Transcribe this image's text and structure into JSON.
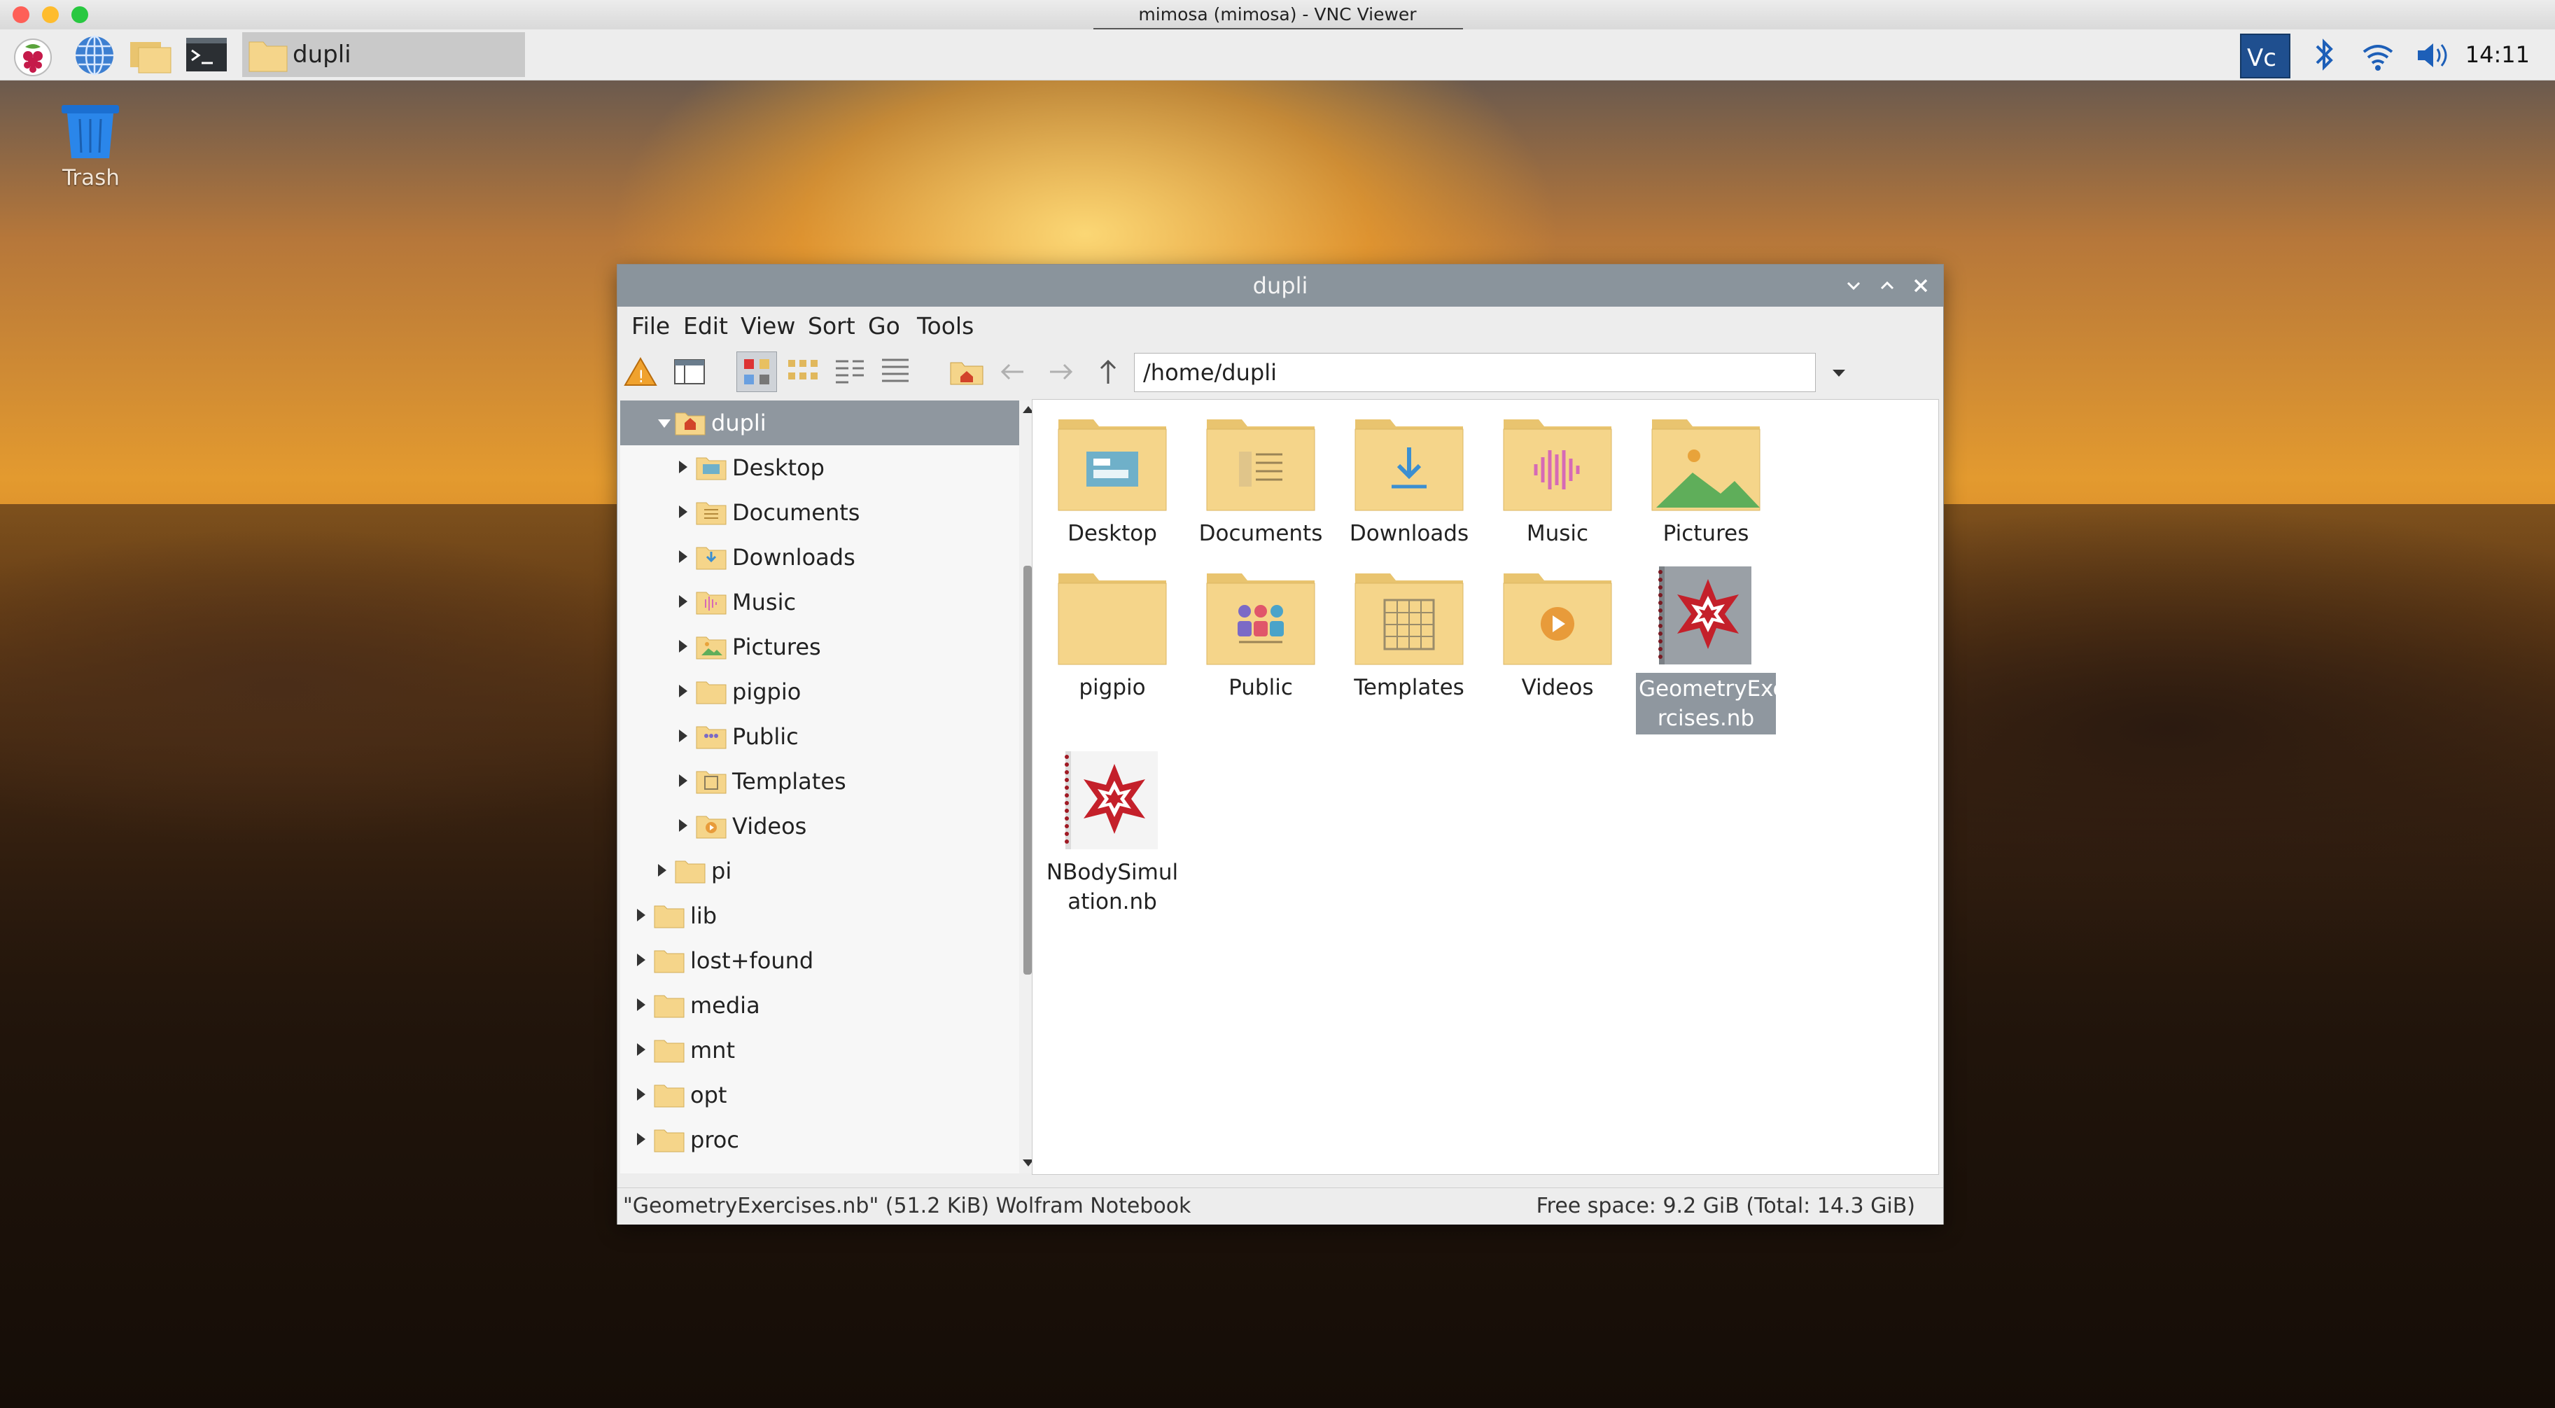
{
  "mac_window": {
    "title": "mimosa (mimosa) - VNC Viewer"
  },
  "taskbar": {
    "window_button_label": "dupli",
    "clock": "14:11",
    "icons": [
      "raspberry-menu-icon",
      "web-browser-icon",
      "file-manager-icon",
      "terminal-icon",
      "vnc-icon",
      "bluetooth-icon",
      "wifi-icon",
      "volume-icon"
    ]
  },
  "desktop": {
    "trash_label": "Trash"
  },
  "file_manager": {
    "title": "dupli",
    "menu": [
      "File",
      "Edit",
      "View",
      "Sort",
      "Go",
      "Tools"
    ],
    "path": "/home/dupli",
    "tree": [
      {
        "label": "dupli",
        "level": 1,
        "expanded": true,
        "selected": true,
        "icon": "home"
      },
      {
        "label": "Desktop",
        "level": 2,
        "icon": "desktop"
      },
      {
        "label": "Documents",
        "level": 2,
        "icon": "documents"
      },
      {
        "label": "Downloads",
        "level": 2,
        "icon": "downloads"
      },
      {
        "label": "Music",
        "level": 2,
        "icon": "music"
      },
      {
        "label": "Pictures",
        "level": 2,
        "icon": "pictures"
      },
      {
        "label": "pigpio",
        "level": 2,
        "icon": "folder"
      },
      {
        "label": "Public",
        "level": 2,
        "icon": "public"
      },
      {
        "label": "Templates",
        "level": 2,
        "icon": "templates"
      },
      {
        "label": "Videos",
        "level": 2,
        "icon": "videos"
      },
      {
        "label": "pi",
        "level": 1,
        "icon": "folder"
      },
      {
        "label": "lib",
        "level": 0,
        "icon": "folder"
      },
      {
        "label": "lost+found",
        "level": 0,
        "icon": "folder"
      },
      {
        "label": "media",
        "level": 0,
        "icon": "folder"
      },
      {
        "label": "mnt",
        "level": 0,
        "icon": "folder"
      },
      {
        "label": "opt",
        "level": 0,
        "icon": "folder"
      },
      {
        "label": "proc",
        "level": 0,
        "icon": "folder"
      }
    ],
    "items": [
      {
        "name": "Desktop",
        "type": "desktop-folder"
      },
      {
        "name": "Documents",
        "type": "documents-folder"
      },
      {
        "name": "Downloads",
        "type": "downloads-folder"
      },
      {
        "name": "Music",
        "type": "music-folder"
      },
      {
        "name": "Pictures",
        "type": "pictures-folder"
      },
      {
        "name": "pigpio",
        "type": "folder"
      },
      {
        "name": "Public",
        "type": "public-folder"
      },
      {
        "name": "Templates",
        "type": "templates-folder"
      },
      {
        "name": "Videos",
        "type": "videos-folder"
      },
      {
        "name_line1": "GeometryExe",
        "name_line2": "rcises.nb",
        "type": "wolfram-notebook",
        "selected": true
      },
      {
        "name_line1": "NBodySimul",
        "name_line2": "ation.nb",
        "type": "wolfram-notebook"
      }
    ],
    "status_left": "\"GeometryExercises.nb\" (51.2 KiB) Wolfram Notebook",
    "status_right": "Free space: 9.2 GiB (Total: 14.3 GiB)"
  },
  "colors": {
    "selection": "#8f979f",
    "folder": "#f5d58a",
    "folder_tab": "#e9c46f",
    "wolfram_red": "#c4202a"
  }
}
